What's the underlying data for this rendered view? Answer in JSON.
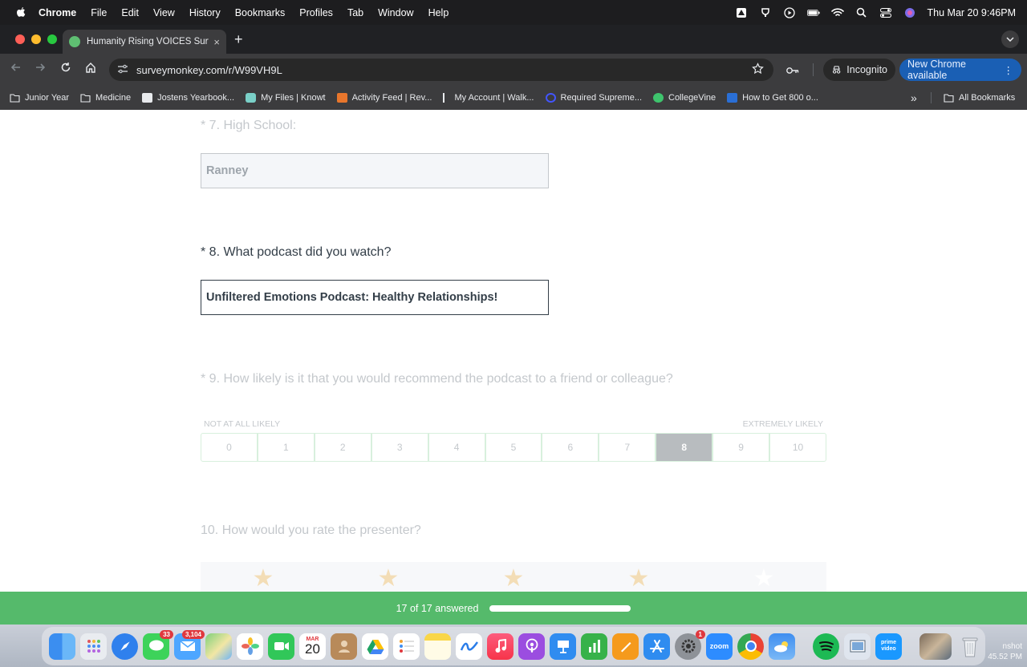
{
  "menubar": {
    "items": [
      "Chrome",
      "File",
      "Edit",
      "View",
      "History",
      "Bookmarks",
      "Profiles",
      "Tab",
      "Window",
      "Help"
    ],
    "clock": "Thu Mar 20  9:46PM"
  },
  "tab": {
    "title": "Humanity Rising VOICES Surv",
    "close": "×",
    "new_tab": "+"
  },
  "address_bar": {
    "url": "surveymonkey.com/r/W99VH9L"
  },
  "toolbar": {
    "incognito_label": "Incognito",
    "update_label": "New Chrome available",
    "more": "⋮"
  },
  "bookmarks": {
    "items": [
      "Junior Year",
      "Medicine",
      "Jostens Yearbook...",
      "My Files | Knowt",
      "Activity Feed | Rev...",
      "My Account | Walk...",
      "Required Supreme...",
      "CollegeVine",
      "How to Get 800 o..."
    ],
    "overflow": "»",
    "all_label": "All Bookmarks"
  },
  "survey": {
    "q7": {
      "label": "* 7. High School:",
      "value": "Ranney"
    },
    "q8": {
      "label": "* 8. What podcast did you watch?",
      "value": "Unfiltered Emotions Podcast: Healthy Relationships!"
    },
    "q9": {
      "label": "* 9. How likely is it that you would recommend the podcast to a friend or colleague?",
      "low_label": "NOT AT ALL LIKELY",
      "high_label": "EXTREMELY LIKELY",
      "options": [
        "0",
        "1",
        "2",
        "3",
        "4",
        "5",
        "6",
        "7",
        "8",
        "9",
        "10"
      ],
      "selected": "8"
    },
    "q10": {
      "label": "10. How would you rate the presenter?",
      "rating": 4,
      "max": 5
    }
  },
  "progress": {
    "text": "17 of 17 answered",
    "fraction": 1.0
  },
  "dock": {
    "badges": {
      "messages": "33",
      "mail": "3,104",
      "settings": "1"
    },
    "calendar_month": "MAR",
    "calendar_day": "20",
    "zoom_label": "zoom",
    "prime_label": "prime video"
  },
  "screenshot_label": {
    "line1": "nshot",
    "line2": "45.52 PM"
  },
  "colors": {
    "accent_green": "#55ba6b",
    "selected_gray": "#b8bcbf",
    "star": "#f3ddb6"
  }
}
